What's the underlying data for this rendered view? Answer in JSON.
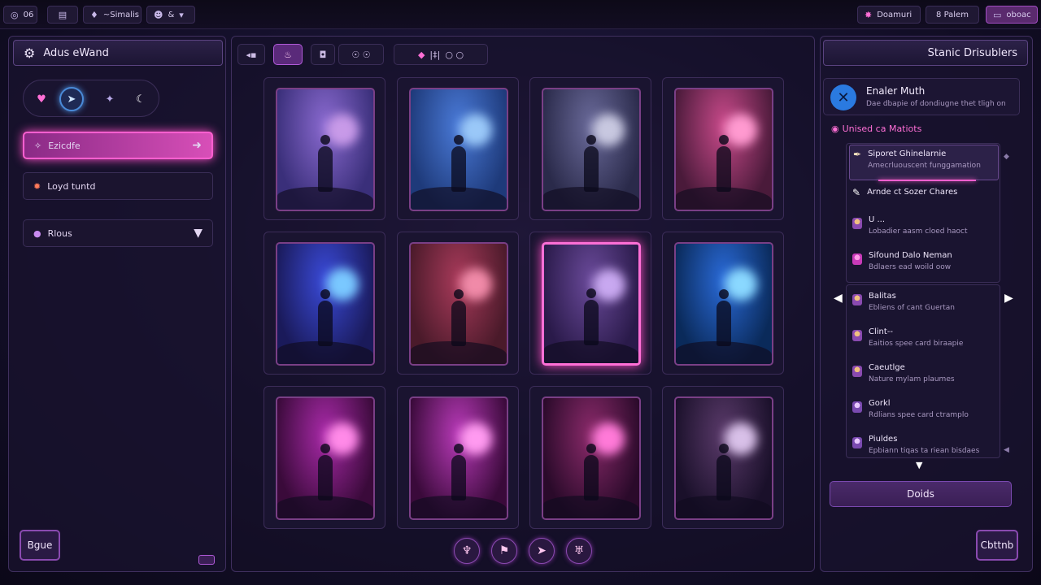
{
  "topbar": {
    "left_items": [
      {
        "icon": "logo-icon",
        "label": "06"
      },
      {
        "icon": "folder-icon",
        "label": ""
      },
      {
        "icon": "drop-icon",
        "label": "~Simalis"
      },
      {
        "icon": "avatar-icon",
        "label": "&"
      }
    ],
    "right_items": [
      {
        "icon": "star-icon",
        "label": "Doamuri"
      },
      {
        "label": "8 Palem"
      },
      {
        "icon": "menu-icon",
        "label": "oboac"
      }
    ]
  },
  "left_panel": {
    "header_title": "Adus eWand",
    "mode_icons": [
      "heart-icon",
      "play-icon",
      "gem-icon",
      "moon-icon"
    ],
    "menu": [
      {
        "label": "Ezicdfe",
        "icon": "sparkle-icon",
        "trailing": "arrow-right-icon",
        "active": true
      },
      {
        "label": "Loyd tuntd",
        "icon": "burst-icon",
        "active": false
      },
      {
        "label": "Rlous",
        "icon": "orb-icon",
        "trailing": "chevron-down-icon",
        "active": false
      }
    ],
    "bottom_button": "Bgue"
  },
  "toolbar": {
    "groups": [
      [
        "back-icon",
        "flame-icon",
        "shield-icon",
        "mask-icon"
      ],
      [
        "lips-icon",
        "bars-icon",
        "ring-icon"
      ]
    ]
  },
  "grid": {
    "cards": [
      {
        "theme": "fairy-dancer",
        "colors": [
          "#3a2f7a",
          "#8a6ad0",
          "#c89ae8"
        ]
      },
      {
        "theme": "shadow-mage",
        "colors": [
          "#1e3a7a",
          "#4a7ad8",
          "#9ac8f8"
        ]
      },
      {
        "theme": "moon-cliffs",
        "colors": [
          "#2a2a4a",
          "#6a6a9a",
          "#c8c8e0"
        ]
      },
      {
        "theme": "pink-sorceress",
        "colors": [
          "#4a1a3a",
          "#c84a8a",
          "#ff9ad0"
        ]
      },
      {
        "theme": "orb-caster",
        "colors": [
          "#1a1a5a",
          "#3a4ad8",
          "#7ac8ff"
        ]
      },
      {
        "theme": "crimson-queen",
        "colors": [
          "#4a1a2a",
          "#a83a5a",
          "#f08aa8"
        ]
      },
      {
        "theme": "cliff-wanderer",
        "colors": [
          "#2a1a4a",
          "#6a4a9a",
          "#c8a8f0"
        ]
      },
      {
        "theme": "spirit-water",
        "colors": [
          "#0a2a5a",
          "#2a6ad8",
          "#8ad8ff"
        ]
      },
      {
        "theme": "winged-angel",
        "colors": [
          "#3a0a3a",
          "#a82aa8",
          "#ff8ae8"
        ]
      },
      {
        "theme": "lightning-witch",
        "colors": [
          "#3a0a3a",
          "#b83ab8",
          "#ff9af0"
        ]
      },
      {
        "theme": "pink-beam",
        "colors": [
          "#2a0a2a",
          "#8a2a6a",
          "#ff7ad8"
        ]
      },
      {
        "theme": "night-mage",
        "colors": [
          "#1a102a",
          "#5a3a6a",
          "#d8c0e8"
        ]
      }
    ],
    "selected_index": 6
  },
  "bottom_actions": [
    "eagle-icon",
    "banner-icon",
    "horn-icon",
    "demon-icon"
  ],
  "right_panel": {
    "header_title": "Stanic Drisublers",
    "profile": {
      "name": "Enaler Muth",
      "subtitle": "Dae dbapie of dondiugne thet tligh on",
      "icon": "cross-icon"
    },
    "section_title": "Unised ca Matiots",
    "list_top": [
      {
        "title": "Siporet Ghinelarnie",
        "subtitle": "Amecrluouscent funggamation",
        "selected": true
      },
      {
        "title": "Arnde ct Sozer Chares",
        "subtitle": ""
      },
      {
        "title": "U ...",
        "subtitle": "Lobadier aasm cloed haoct"
      },
      {
        "title": "Sifound Dalo Neman",
        "subtitle": "Bdlaers ead woild oow"
      }
    ],
    "list_bottom": [
      {
        "title": "Balitas",
        "subtitle": "Ebliens of cant Guertan"
      },
      {
        "title": "Clint--",
        "subtitle": "Eaitios spee card biraapie"
      },
      {
        "title": "Caeutlge",
        "subtitle": "Nature mylam plaumes"
      },
      {
        "title": "Gorkl",
        "subtitle": "Rdlians spee card ctramplo"
      },
      {
        "title": "Piuldes",
        "subtitle": "Epbiann tiqas ta riean bisdaes"
      }
    ],
    "action_button": "Doids",
    "corner_button": "Cbttnb"
  }
}
